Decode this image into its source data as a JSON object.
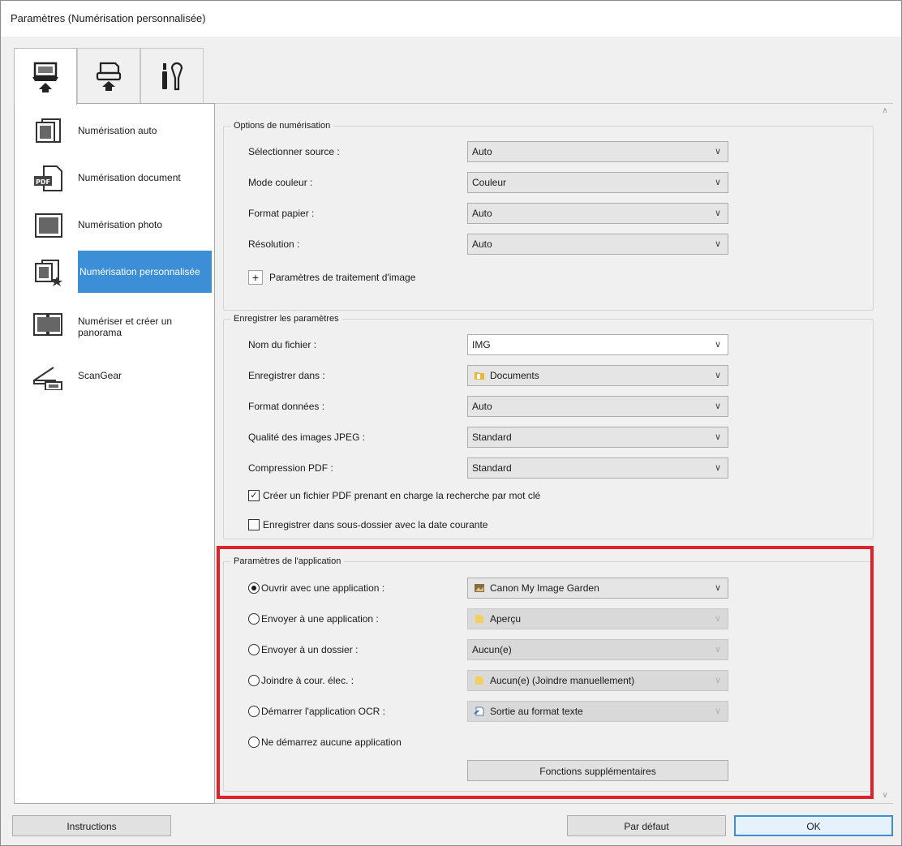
{
  "window": {
    "title": "Paramètres (Numérisation personnalisée)"
  },
  "tabs": [
    {
      "icon": "scan-from-computer-icon"
    },
    {
      "icon": "scan-from-panel-icon"
    },
    {
      "icon": "general-settings-icon"
    }
  ],
  "sidebar": {
    "items": [
      {
        "label": "Numérisation auto",
        "icon": "auto-scan-icon"
      },
      {
        "label": "Numérisation document",
        "icon": "pdf-document-icon"
      },
      {
        "label": "Numérisation photo",
        "icon": "photo-icon"
      },
      {
        "label": "Numérisation personnalisée",
        "icon": "custom-scan-icon",
        "selected": true
      },
      {
        "label": "Numériser et créer un panorama",
        "icon": "panorama-icon"
      },
      {
        "label": "ScanGear",
        "icon": "scangear-icon"
      }
    ]
  },
  "scan_options": {
    "legend": "Options de numérisation",
    "source_label": "Sélectionner source :",
    "source_value": "Auto",
    "color_label": "Mode couleur :",
    "color_value": "Couleur",
    "paper_label": "Format papier :",
    "paper_value": "Auto",
    "resolution_label": "Résolution :",
    "resolution_value": "Auto",
    "image_processing_label": "Paramètres de traitement d'image"
  },
  "save_settings": {
    "legend": "Enregistrer les paramètres",
    "filename_label": "Nom du fichier :",
    "filename_value": "IMG",
    "save_in_label": "Enregistrer dans :",
    "save_in_value": "Documents",
    "data_format_label": "Format données :",
    "data_format_value": "Auto",
    "jpeg_quality_label": "Qualité des images JPEG :",
    "jpeg_quality_value": "Standard",
    "pdf_compression_label": "Compression PDF :",
    "pdf_compression_value": "Standard",
    "searchable_pdf_label": "Créer un fichier PDF prenant en charge la recherche par mot clé",
    "searchable_pdf_checked": true,
    "subfolder_label": "Enregistrer dans sous-dossier avec la date courante",
    "subfolder_checked": false
  },
  "app_settings": {
    "legend": "Paramètres de l'application",
    "open_app_label": "Ouvrir avec une application :",
    "open_app_value": "Canon My Image Garden",
    "send_app_label": "Envoyer à une application :",
    "send_app_value": "Aperçu",
    "send_folder_label": "Envoyer à un dossier :",
    "send_folder_value": "Aucun(e)",
    "attach_email_label": "Joindre à cour. élec. :",
    "attach_email_value": "Aucun(e) (Joindre manuellement)",
    "ocr_label": "Démarrer l'application OCR :",
    "ocr_value": "Sortie au format texte",
    "no_app_label": "Ne démarrez aucune application",
    "selected_option": "open_app",
    "more_functions_label": "Fonctions supplémentaires"
  },
  "footer": {
    "instructions_label": "Instructions",
    "defaults_label": "Par défaut",
    "ok_label": "OK"
  },
  "colors": {
    "selection": "#3c8fd6",
    "highlight_frame": "#e3202a"
  }
}
